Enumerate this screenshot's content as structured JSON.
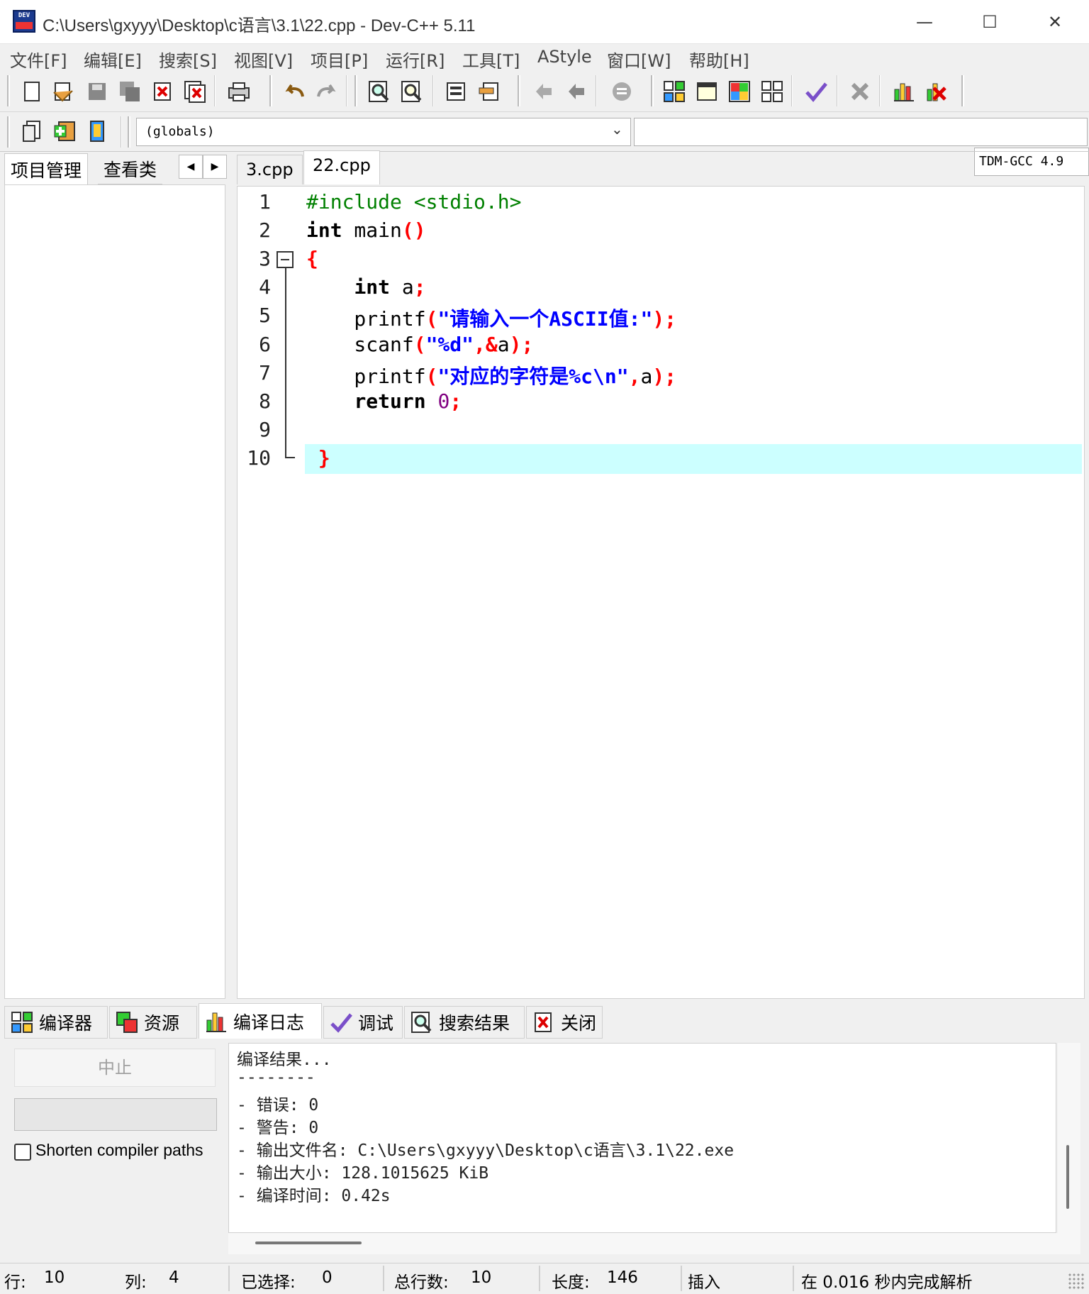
{
  "window": {
    "title": "C:\\Users\\gxyyy\\Desktop\\c语言\\3.1\\22.cpp - Dev-C++ 5.11",
    "app_icon_text": "DEV",
    "minimize_glyph": "—",
    "maximize_glyph": "☐",
    "close_glyph": "✕"
  },
  "menu": [
    "文件[F]",
    "编辑[E]",
    "搜索[S]",
    "视图[V]",
    "项目[P]",
    "运行[R]",
    "工具[T]",
    "AStyle",
    "窗口[W]",
    "帮助[H]"
  ],
  "toolbar": {
    "compiler": "TDM-GCC 4.9",
    "scope_select": "(globals)",
    "icons": [
      "new-file-icon",
      "open-file-icon",
      "save-icon",
      "save-all-icon",
      "close-file-icon",
      "close-all-icon",
      "print-icon",
      "undo-icon",
      "redo-icon",
      "find-icon",
      "replace-icon",
      "indent-icon",
      "unindent-icon",
      "goto-back-icon",
      "goto-forward-icon",
      "bookmark-icon",
      "compile-icon",
      "run-icon",
      "compile-run-icon",
      "rebuild-icon",
      "check-syntax-icon",
      "stop-icon",
      "profile-icon",
      "delete-profile-icon",
      "new-project-icon",
      "add-to-project-icon",
      "remove-from-project-icon"
    ]
  },
  "left_panel": {
    "tabs": [
      "项目管理",
      "查看类"
    ],
    "nav_left": "◀",
    "nav_right": "▶"
  },
  "editor": {
    "tabs": [
      "3.cpp",
      "22.cpp"
    ],
    "active_tab": "22.cpp",
    "line_numbers": [
      "1",
      "2",
      "3",
      "4",
      "5",
      "6",
      "7",
      "8",
      "9",
      "10"
    ],
    "lines": [
      [
        {
          "t": "#include <stdio.h>",
          "c": "pp"
        }
      ],
      [
        {
          "t": "int",
          "c": "kw"
        },
        {
          "t": " main",
          "c": ""
        },
        {
          "t": "()",
          "c": "sym"
        }
      ],
      [
        {
          "t": "{",
          "c": "sym"
        }
      ],
      [
        {
          "t": "    ",
          "c": ""
        },
        {
          "t": "int",
          "c": "kw"
        },
        {
          "t": " a",
          "c": ""
        },
        {
          "t": ";",
          "c": "sym"
        }
      ],
      [
        {
          "t": "    printf",
          "c": ""
        },
        {
          "t": "(",
          "c": "sym"
        },
        {
          "t": "\"请输入一个ASCII值:\"",
          "c": "str"
        },
        {
          "t": ");",
          "c": "sym"
        }
      ],
      [
        {
          "t": "    scanf",
          "c": ""
        },
        {
          "t": "(",
          "c": "sym"
        },
        {
          "t": "\"%d\"",
          "c": "str"
        },
        {
          "t": ",&",
          "c": "sym"
        },
        {
          "t": "a",
          "c": ""
        },
        {
          "t": ");",
          "c": "sym"
        }
      ],
      [
        {
          "t": "    printf",
          "c": ""
        },
        {
          "t": "(",
          "c": "sym"
        },
        {
          "t": "\"对应的字符是%c\\n\"",
          "c": "str"
        },
        {
          "t": ",",
          "c": "sym"
        },
        {
          "t": "a",
          "c": ""
        },
        {
          "t": ");",
          "c": "sym"
        }
      ],
      [
        {
          "t": "    ",
          "c": ""
        },
        {
          "t": "return",
          "c": "kw"
        },
        {
          "t": " ",
          "c": ""
        },
        {
          "t": "0",
          "c": "num"
        },
        {
          "t": ";",
          "c": "sym"
        }
      ],
      [],
      [
        {
          "t": " ",
          "c": ""
        },
        {
          "t": "}",
          "c": "sym"
        }
      ]
    ],
    "current_line": 10
  },
  "bottom_tabs": [
    {
      "label": "编译器",
      "icon": "compiler-grid-icon"
    },
    {
      "label": "资源",
      "icon": "resources-icon"
    },
    {
      "label": "编译日志",
      "icon": "compile-log-chart-icon"
    },
    {
      "label": "调试",
      "icon": "debug-check-icon"
    },
    {
      "label": "搜索结果",
      "icon": "search-results-icon"
    },
    {
      "label": "关闭",
      "icon": "close-panel-icon"
    }
  ],
  "compile_panel": {
    "abort_button": "中止",
    "shorten_paths_label": "Shorten compiler paths",
    "shorten_paths_checked": false
  },
  "log": [
    "编译结果...",
    "--------",
    "- 错误: 0",
    "- 警告: 0",
    "- 输出文件名: C:\\Users\\gxyyy\\Desktop\\c语言\\3.1\\22.exe",
    "- 输出大小: 128.1015625 KiB",
    "- 编译时间: 0.42s"
  ],
  "status": {
    "row_label": "行:",
    "row_value": "10",
    "col_label": "列:",
    "col_value": "4",
    "sel_label": "已选择:",
    "sel_value": "0",
    "lines_label": "总行数:",
    "lines_value": "10",
    "len_label": "长度:",
    "len_value": "146",
    "mode": "插入",
    "parse_msg": "在 0.016 秒内完成解析"
  },
  "colors": {
    "current_line_bg": "#ccffff",
    "keyword": "#000000",
    "preprocessor": "#008000",
    "symbol": "#ff0000",
    "string": "#0000ff",
    "number": "#800080"
  }
}
